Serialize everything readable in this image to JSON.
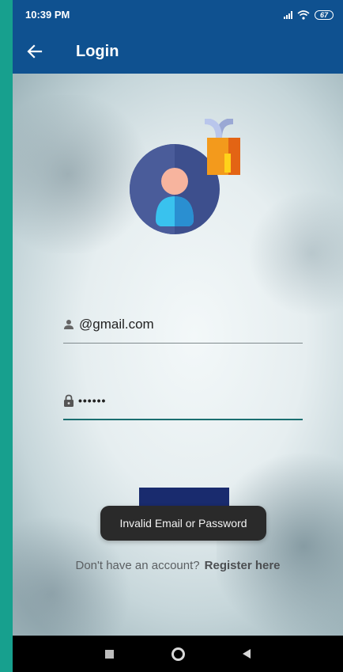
{
  "status_bar": {
    "time": "10:39 PM",
    "battery": "67"
  },
  "app_bar": {
    "title": "Login",
    "back_icon": "arrow-left-icon"
  },
  "form": {
    "email_value": "@gmail.com",
    "email_icon": "person-icon",
    "password_value": "••••••",
    "password_icon": "lock-icon"
  },
  "toast": {
    "message": "Invalid Email or Password"
  },
  "register": {
    "prompt": "Don't have an account?",
    "link": "Register here"
  },
  "colors": {
    "app_bar": "#0f5190",
    "button": "#192b6e",
    "outer_background": "#17a08e",
    "toast": "#2a2a2a"
  }
}
